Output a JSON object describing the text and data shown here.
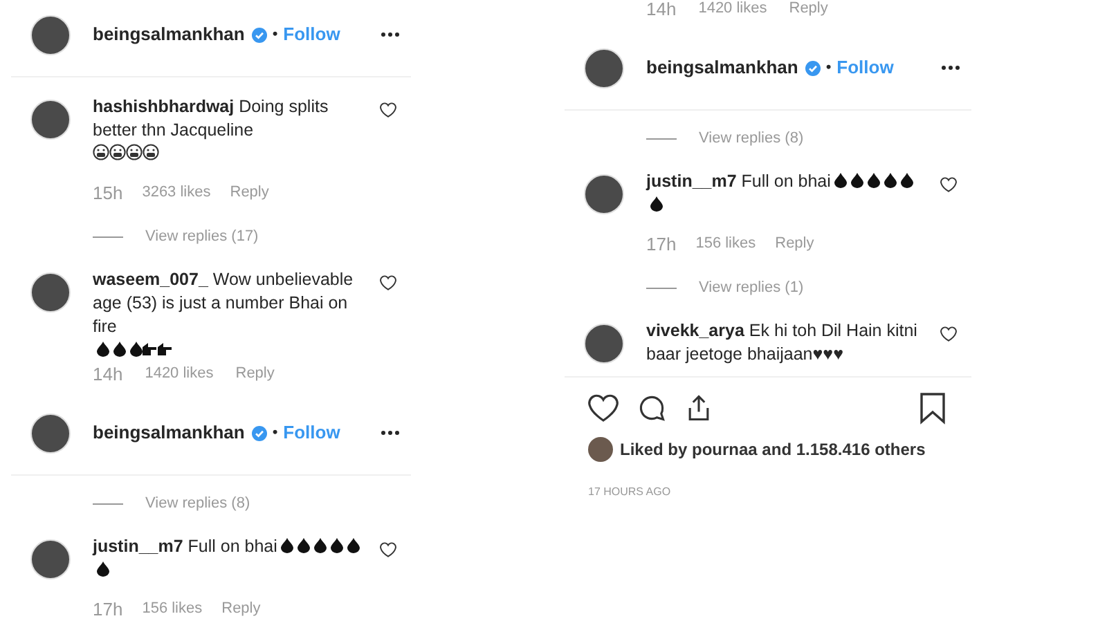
{
  "columns": [
    {
      "blocks": [
        {
          "kind": "header",
          "username": "beingsalmankhan",
          "separator": "•",
          "follow": "Follow"
        },
        {
          "kind": "divider"
        },
        {
          "kind": "comment",
          "text": "**hashishbhardwaj** Doing splits better thn Jacqueline",
          "emojis": [
            {
              "kind": "face"
            },
            {
              "kind": "face"
            },
            {
              "kind": "face"
            },
            {
              "kind": "face"
            }
          ]
        },
        {
          "kind": "meta",
          "time": "15h",
          "likes": "3263 likes",
          "reply": "Reply",
          "cut": false
        },
        {
          "kind": "replies",
          "label": "View replies (17)"
        },
        {
          "kind": "comment",
          "text": "**waseem_007_** Wow unbelievable age (53) is just a number Bhai on fire",
          "emojis": [
            {
              "kind": "drop"
            },
            {
              "kind": "drop"
            },
            {
              "kind": "drop"
            },
            {
              "kind": "hands"
            },
            {
              "kind": "hands"
            }
          ]
        },
        {
          "kind": "meta",
          "time": "14h",
          "likes": "1420 likes",
          "reply": "Reply",
          "cut": true
        },
        {
          "kind": "header",
          "username": "beingsalmankhan",
          "separator": "•",
          "follow": "Follow"
        },
        {
          "kind": "divider"
        },
        {
          "kind": "replies",
          "label": "View replies (8)"
        },
        {
          "kind": "comment",
          "text": "**justin__m7** Full on bhai",
          "emojis": [
            {
              "kind": "drop"
            },
            {
              "kind": "drop"
            },
            {
              "kind": "drop"
            },
            {
              "kind": "drop"
            },
            {
              "kind": "drop"
            },
            {
              "kind": "drop"
            }
          ]
        },
        {
          "kind": "meta",
          "time": "17h",
          "likes": "156 likes",
          "reply": "Reply",
          "cut": false
        }
      ]
    },
    {
      "blocks": [
        {
          "kind": "meta",
          "time": "14h",
          "likes": "1420 likes",
          "reply": "Reply",
          "cut": true
        },
        {
          "kind": "header",
          "username": "beingsalmankhan",
          "separator": "•",
          "follow": "Follow"
        },
        {
          "kind": "divider"
        },
        {
          "kind": "replies",
          "label": "View replies (8)"
        },
        {
          "kind": "comment",
          "text": "**justin__m7** Full on bhai",
          "emojis": [
            {
              "kind": "drop"
            },
            {
              "kind": "drop"
            },
            {
              "kind": "drop"
            },
            {
              "kind": "drop"
            },
            {
              "kind": "drop"
            },
            {
              "kind": "drop"
            }
          ]
        },
        {
          "kind": "meta",
          "time": "17h",
          "likes": "156 likes",
          "reply": "Reply",
          "cut": false
        },
        {
          "kind": "replies",
          "label": "View replies (1)"
        },
        {
          "kind": "comment",
          "text": "**vivekk_arya** Ek hi toh Dil Hain kitni baar jeetoge bhaijaan♥♥♥"
        },
        {
          "kind": "divider"
        },
        {
          "kind": "actions"
        },
        {
          "kind": "likes",
          "text": "Liked by pournaa and 1.158.416 others"
        },
        {
          "kind": "timestamp",
          "text": "17 HOURS AGO"
        }
      ]
    }
  ]
}
